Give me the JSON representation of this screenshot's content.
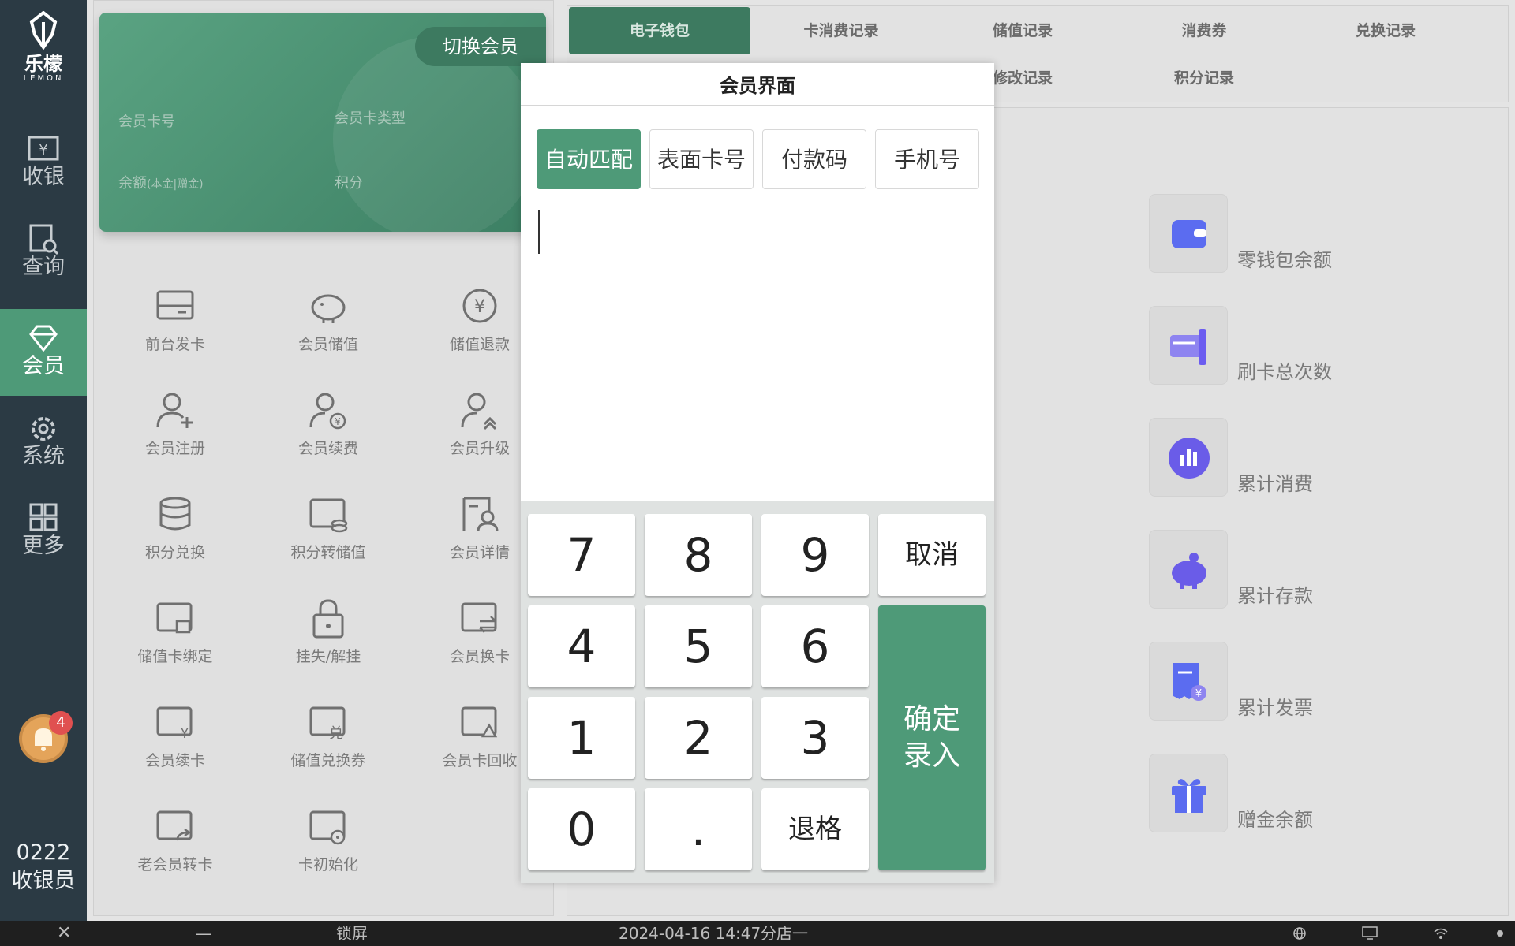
{
  "sidebar": {
    "logo_cn": "乐檬",
    "logo_en": "LEMON",
    "items": [
      {
        "label": "收银",
        "icon": "cash-register-icon"
      },
      {
        "label": "查询",
        "icon": "search-doc-icon"
      },
      {
        "label": "会员",
        "icon": "diamond-icon"
      },
      {
        "label": "系统",
        "icon": "gear-icon"
      },
      {
        "label": "更多",
        "icon": "grid-icon"
      }
    ],
    "active_item": "会员",
    "notification_count": "4",
    "user_id": "0222",
    "user_role": "收银员"
  },
  "member_card": {
    "switch_label": "切换会员",
    "card_no_label": "会员卡号",
    "card_type_label": "会员卡类型",
    "balance_label": "余额",
    "balance_sub": "(本金|赠金)",
    "points_label": "积分"
  },
  "functions": [
    {
      "label": "前台发卡",
      "icon": "card-icon"
    },
    {
      "label": "会员储值",
      "icon": "piggy-bank-icon"
    },
    {
      "label": "储值退款",
      "icon": "yen-refund-icon"
    },
    {
      "label": "会员注册",
      "icon": "user-add-icon"
    },
    {
      "label": "会员续费",
      "icon": "user-yen-icon"
    },
    {
      "label": "会员升级",
      "icon": "user-upgrade-icon"
    },
    {
      "label": "积分兑换",
      "icon": "database-icon"
    },
    {
      "label": "积分转储值",
      "icon": "card-coins-icon"
    },
    {
      "label": "会员详情",
      "icon": "user-detail-icon"
    },
    {
      "label": "储值卡绑定",
      "icon": "card-bind-icon"
    },
    {
      "label": "挂失/解挂",
      "icon": "lock-icon"
    },
    {
      "label": "会员换卡",
      "icon": "card-swap-icon"
    },
    {
      "label": "会员续卡",
      "icon": "card-yen-icon"
    },
    {
      "label": "储值兑换券",
      "icon": "card-exchange-icon"
    },
    {
      "label": "会员卡回收",
      "icon": "card-recycle-icon"
    },
    {
      "label": "老会员转卡",
      "icon": "card-transfer-icon"
    },
    {
      "label": "卡初始化",
      "icon": "card-reset-icon"
    }
  ],
  "tabs": [
    "电子钱包",
    "卡消费记录",
    "储值记录",
    "消费券",
    "兑换记录",
    "修改记录",
    "积分记录"
  ],
  "active_tab": "电子钱包",
  "stats": [
    {
      "label": "零钱包余额",
      "icon": "wallet-icon",
      "color": "#5b6cf0"
    },
    {
      "label": "刷卡总次数",
      "icon": "card-swipe-icon",
      "color": "#6b5cf0"
    },
    {
      "label": "累计消费",
      "icon": "bar-chart-icon",
      "color": "#6a5ce8"
    },
    {
      "label": "累计存款",
      "icon": "piggy-bank-icon",
      "color": "#6a5ce8"
    },
    {
      "label": "累计发票",
      "icon": "invoice-icon",
      "color": "#5b6cf0"
    },
    {
      "label": "赠金余额",
      "icon": "gift-icon",
      "color": "#5b6cf0"
    }
  ],
  "modal": {
    "title": "会员界面",
    "modes": [
      "自动匹配",
      "表面卡号",
      "付款码",
      "手机号"
    ],
    "active_mode": "自动匹配",
    "input_value": "",
    "keys": [
      "7",
      "8",
      "9",
      "取消",
      "4",
      "5",
      "6",
      "1",
      "2",
      "3",
      "0",
      ".",
      "退格"
    ],
    "confirm_label": "确定录入"
  },
  "taskbar": {
    "close": "✕",
    "minimize": "—",
    "lock": "锁屏",
    "datetime": "2024-04-16 14:47",
    "store": "分店一"
  },
  "colors": {
    "primary": "#4e9a78",
    "sidebar": "#2b3a44",
    "accent_purple": "#6a5ce8"
  }
}
